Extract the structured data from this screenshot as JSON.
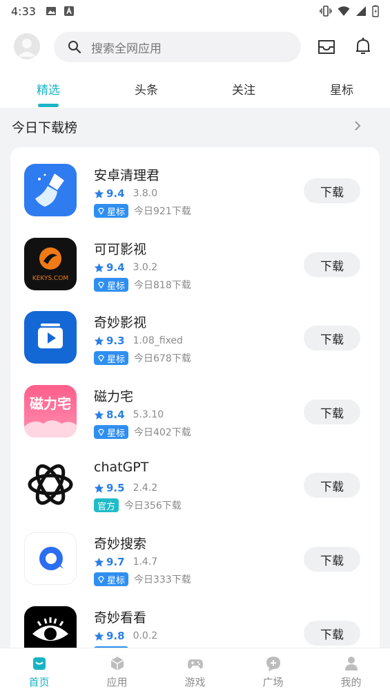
{
  "status_bar": {
    "time": "4:33"
  },
  "search": {
    "placeholder": "搜索全网应用"
  },
  "tabs": [
    {
      "label": "精选",
      "active": true
    },
    {
      "label": "头条",
      "active": false
    },
    {
      "label": "关注",
      "active": false
    },
    {
      "label": "星标",
      "active": false
    }
  ],
  "section": {
    "title": "今日下载榜"
  },
  "apps": [
    {
      "name": "安卓清理君",
      "rating": "9.4",
      "version": "3.8.0",
      "badge": "星标",
      "downloads": "今日921下载",
      "button": "下载",
      "icon": "broom-icon"
    },
    {
      "name": "可可影视",
      "rating": "9.4",
      "version": "3.0.2",
      "badge": "星标",
      "downloads": "今日818下载",
      "button": "下载",
      "icon": "kekys-logo-icon"
    },
    {
      "name": "奇妙影视",
      "rating": "9.3",
      "version": "1.08_fixed",
      "badge": "星标",
      "downloads": "今日678下载",
      "button": "下载",
      "icon": "play-box-icon"
    },
    {
      "name": "磁力宅",
      "rating": "8.4",
      "version": "5.3.10",
      "badge": "星标",
      "downloads": "今日402下载",
      "button": "下载",
      "icon": "cililzhai-logo-icon",
      "icon_text": "磁力宅"
    },
    {
      "name": "chatGPT",
      "rating": "9.5",
      "version": "2.4.2",
      "badge": "官方",
      "downloads": "今日356下载",
      "button": "下载",
      "icon": "openai-logo-icon"
    },
    {
      "name": "奇妙搜索",
      "rating": "9.7",
      "version": "1.4.7",
      "badge": "星标",
      "downloads": "今日333下载",
      "button": "下载",
      "icon": "search-bubble-icon"
    },
    {
      "name": "奇妙看看",
      "rating": "9.8",
      "version": "0.0.2",
      "badge": "星标",
      "downloads": "",
      "button": "下载",
      "icon": "eye-icon"
    }
  ],
  "bottom_nav": [
    {
      "label": "首页",
      "icon": "home-icon",
      "active": true
    },
    {
      "label": "应用",
      "icon": "cube-icon",
      "active": false
    },
    {
      "label": "游戏",
      "icon": "gamepad-icon",
      "active": false
    },
    {
      "label": "广场",
      "icon": "chat-plus-icon",
      "active": false
    },
    {
      "label": "我的",
      "icon": "person-icon",
      "active": false
    }
  ],
  "colors": {
    "accent": "#19b4c4",
    "rating": "#2a7fe6",
    "star_badge": "#2f8ff0",
    "official_badge": "#1fbcc8"
  }
}
